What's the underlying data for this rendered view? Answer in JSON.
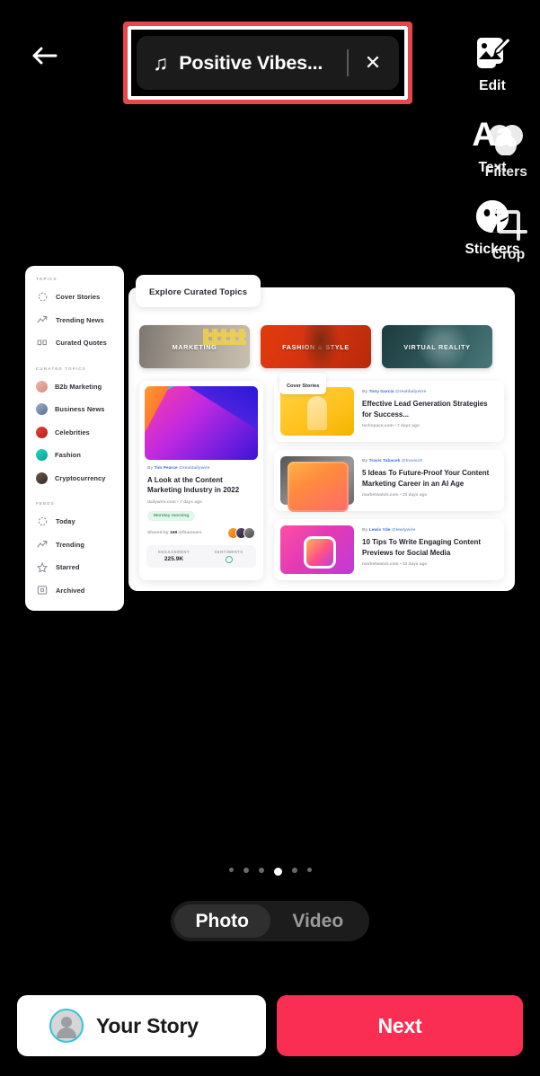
{
  "topbar": {
    "back_icon": "back-arrow-icon",
    "music": {
      "note_icon": "music-note-icon",
      "title": "Positive Vibes...",
      "close_icon": "close-icon"
    }
  },
  "tools": [
    {
      "label": "Edit",
      "icon": "edit-image-icon"
    },
    {
      "label": "Text",
      "icon": "text-aa-icon",
      "glyph": "Aa"
    },
    {
      "label": "Stickers",
      "icon": "sticker-face-icon"
    },
    {
      "label": "Filters",
      "icon": "filters-circles-icon"
    },
    {
      "label": "Crop",
      "icon": "crop-icon"
    }
  ],
  "screenshot": {
    "sidebar": {
      "groups": [
        {
          "title": "TOPICS",
          "items": [
            {
              "label": "Cover Stories",
              "icon": "dashed-circle-icon"
            },
            {
              "label": "Trending News",
              "icon": "trend-arrow-icon"
            },
            {
              "label": "Curated Quotes",
              "icon": "quote-icon"
            }
          ]
        },
        {
          "title": "CURATED TOPICS",
          "items": [
            {
              "label": "B2b Marketing",
              "icon": "avatar-icon",
              "color": "#e8a9a0"
            },
            {
              "label": "Business News",
              "icon": "avatar-icon",
              "color": "#7f95b8"
            },
            {
              "label": "Celebrities",
              "icon": "avatar-icon",
              "color": "#d8302e"
            },
            {
              "label": "Fashion",
              "icon": "avatar-icon",
              "color": "#14c7b8"
            },
            {
              "label": "Cryptocurrency",
              "icon": "avatar-icon",
              "color": "#5a4a42"
            }
          ]
        },
        {
          "title": "FEEDS",
          "items": [
            {
              "label": "Today",
              "icon": "dashed-circle-icon"
            },
            {
              "label": "Trending",
              "icon": "trend-arrow-icon"
            },
            {
              "label": "Starred",
              "icon": "star-icon"
            },
            {
              "label": "Archived",
              "icon": "archive-box-icon"
            }
          ]
        }
      ]
    },
    "main": {
      "tab": "Explore Curated Topics",
      "topic_cards": [
        {
          "label": "MARKETING"
        },
        {
          "label": "FASHION & STYLE"
        },
        {
          "label": "VIRTUAL REALITY"
        }
      ],
      "feature": {
        "by_prefix": "By ",
        "author": "Tim Pearce",
        "handle": "@realdailywire",
        "title": "A Look at the Content Marketing Industry in 2022",
        "source": "dailywire.com • 7 days ago",
        "tag": "Monday morning",
        "shared_prefix": "Shared by ",
        "shared_count": "169",
        "shared_suffix": " influencers",
        "stats": [
          {
            "key": "ENGAGEMENT",
            "value": "225.9K"
          },
          {
            "key": "SENTIMENTS",
            "value": ""
          }
        ]
      },
      "cover_chip": "Cover Stories",
      "articles": [
        {
          "by_prefix": "By ",
          "author": "Tony Garcia",
          "handle": "@realdailywire",
          "title": "Effective Lead Generation Strategies for Success...",
          "source": "techspace.com • 7 days ago"
        },
        {
          "by_prefix": "By ",
          "author": "Travis Tabacek",
          "handle": "@travisch",
          "title": "5 Ideas To Future-Proof Your Content Marketing Career in an AI Age",
          "source": "marketwatch.com • 23 days ago"
        },
        {
          "by_prefix": "By ",
          "author": "Lewis Yde",
          "handle": "@lewlywire",
          "title": "10 Tips To Write Engaging Content Previews for Social Media",
          "source": "marketwatch.com • 23 days ago"
        }
      ]
    }
  },
  "pagination": {
    "total": 6,
    "active_index": 3
  },
  "mode": {
    "photo": "Photo",
    "video": "Video",
    "selected": "Photo"
  },
  "actions": {
    "story_label": "Your Story",
    "next_label": "Next",
    "next_color": "#fa2d52"
  },
  "annotation": {
    "border_color": "#e8464b"
  }
}
